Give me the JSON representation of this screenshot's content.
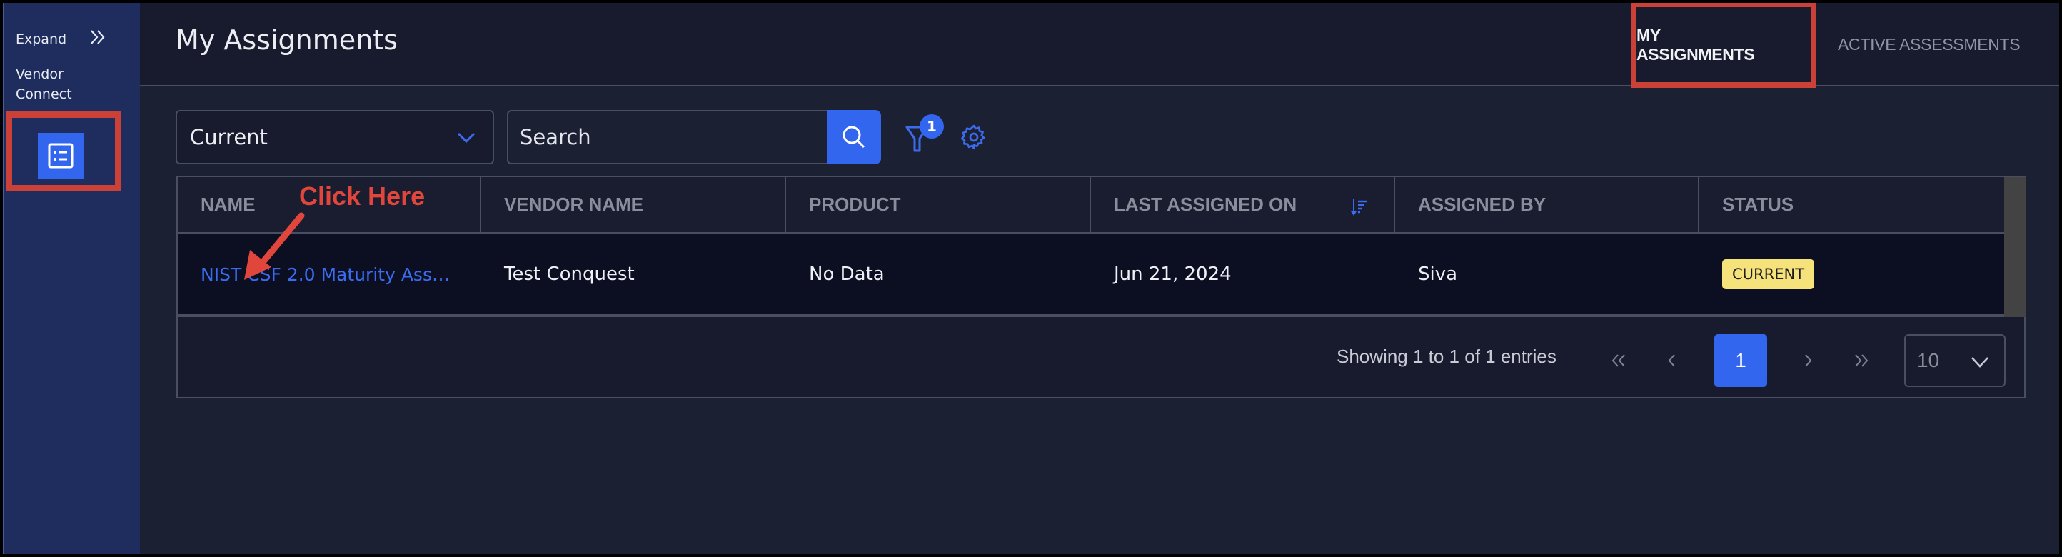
{
  "sidebar": {
    "expand_label": "Expand",
    "expand_icon": "double-chevron-right-icon",
    "app_name_line1": "Vendor",
    "app_name_line2": "Connect",
    "nav_items": [
      {
        "icon": "list-icon",
        "label": "My Assignments",
        "active": true
      }
    ]
  },
  "header": {
    "title": "My Assignments",
    "tabs": [
      {
        "label": "MY ASSIGNMENTS",
        "active": true
      },
      {
        "label": "ACTIVE ASSESSMENTS",
        "active": false
      }
    ]
  },
  "toolbar": {
    "status_select": {
      "value": "Current"
    },
    "search": {
      "placeholder": "Search",
      "value": ""
    },
    "filter_count": "1"
  },
  "table": {
    "columns": [
      "NAME",
      "VENDOR NAME",
      "PRODUCT",
      "LAST ASSIGNED ON",
      "ASSIGNED BY",
      "STATUS"
    ],
    "sorted_column": "LAST ASSIGNED ON",
    "sort_direction": "descending",
    "rows": [
      {
        "name": "NIST CSF 2.0 Maturity Ass…",
        "vendor_name": "Test Conquest",
        "product": "No Data",
        "last_assigned_on": "Jun 21, 2024",
        "assigned_by": "Siva",
        "status": "CURRENT"
      }
    ]
  },
  "pagination": {
    "summary": "Showing 1 to 1 of 1 entries",
    "current_page": "1",
    "page_size": "10"
  },
  "annotation": {
    "text": "Click Here"
  },
  "colors": {
    "accent": "#3366ee",
    "sidebar_bg": "#1e2d5e",
    "header_bg": "#181b2d",
    "page_bg": "#1c2033",
    "row_bg": "#0c0e22",
    "status_current": "#f6e27a",
    "annotation_red": "#cc4137"
  }
}
